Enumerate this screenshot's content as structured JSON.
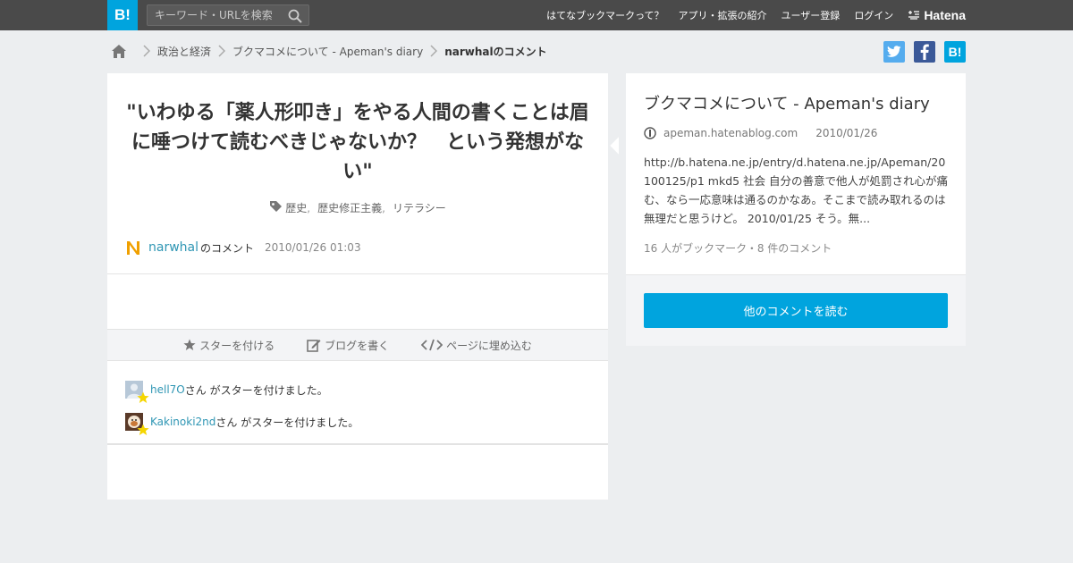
{
  "header": {
    "logo_text": "B!",
    "search_placeholder": "キーワード・URLを検索",
    "nav": [
      "はてなブックマークって？",
      "アプリ・拡張の紹介",
      "ユーザー登録",
      "ログイン"
    ],
    "brand": "Hatena"
  },
  "breadcrumb": {
    "items": [
      "政治と経済",
      "ブクマコメについて - Apeman's diary"
    ],
    "current": "narwhalのコメント"
  },
  "share": {
    "twitter": "t",
    "facebook": "f",
    "hatena": "B!"
  },
  "comment": {
    "text": "\"いわゆる「薬人形叩き」をやる人間の書くことは眉に唾つけて読むべきじゃないか？　という発想がない\"",
    "tags": [
      "歴史",
      "歴史修正主義",
      "リテラシー"
    ],
    "user": "narwhal",
    "user_suffix": "のコメント",
    "date": "2010/01/26 01:03"
  },
  "actions": {
    "star": "スターを付ける",
    "blog": "ブログを書く",
    "embed": "ページに埋め込む"
  },
  "stars": [
    {
      "user": "hell7O",
      "text": "さん がスターを付けました。"
    },
    {
      "user": "Kakinoki2nd",
      "text": "さん がスターを付けました。"
    }
  ],
  "entry": {
    "title": "ブクマコメについて - Apeman's diary",
    "domain": "apeman.hatenablog.com",
    "date": "2010/01/26",
    "description": "http://b.hatena.ne.jp/entry/d.hatena.ne.jp/Apeman/20100125/p1 mkd5 社会 自分の善意で他人が処罰され心が痛む、なら一応意味は通るのかなあ。そこまで読み取れるのは無理だと思うけど。 2010/01/25 そう。無...",
    "count": "16 人がブックマーク・8 件のコメント",
    "read_more": "他のコメントを読む"
  },
  "colors": {
    "accent": "#00a4de",
    "header_bg": "#4a4a4a",
    "link": "#2f96b4",
    "twitter": "#55acee",
    "facebook": "#3b5998",
    "star": "#f5d600"
  }
}
